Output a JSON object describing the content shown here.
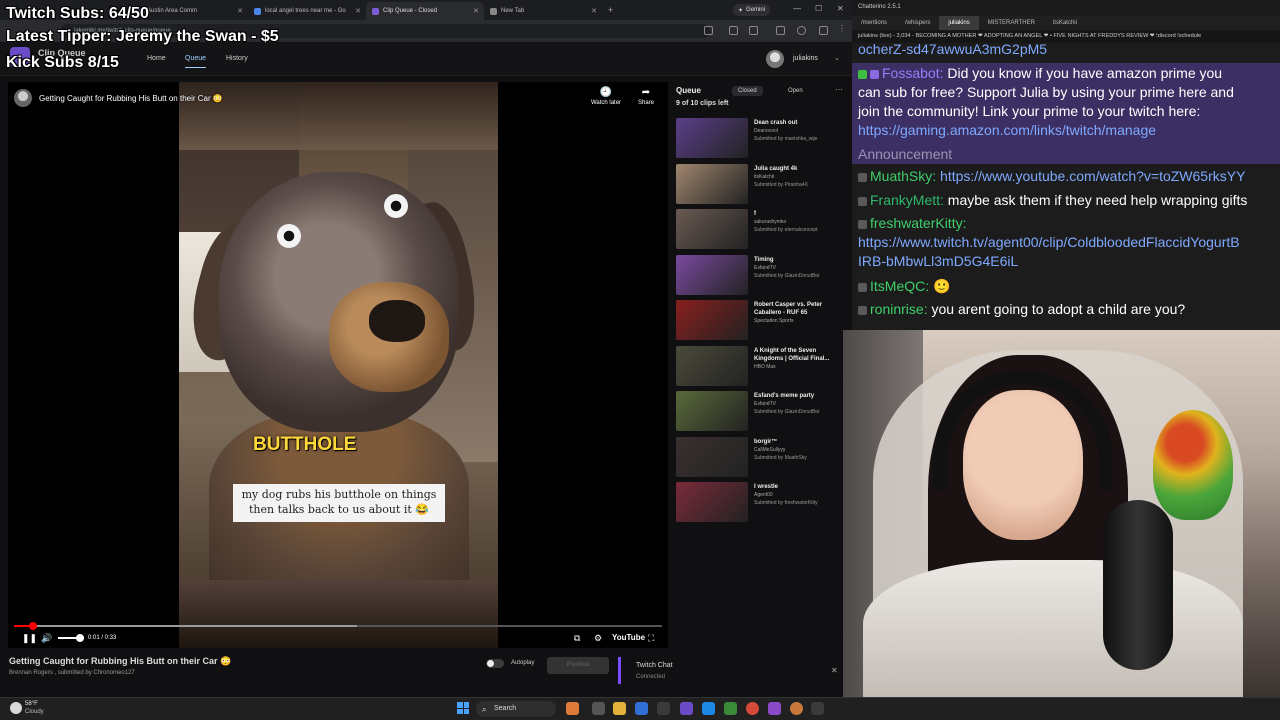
{
  "browser": {
    "tabs": [
      {
        "title": "Austin Area Comm"
      },
      {
        "title": "local angel trees near me - Go"
      },
      {
        "title": "Clip Queue - Closed"
      },
      {
        "title": "New Tab"
      }
    ],
    "gemini_label": "Gemini",
    "url": "jakemiki.me/twitch-clip-queue/queue"
  },
  "site": {
    "name": "Clip Queue",
    "nav": [
      "Home",
      "Queue",
      "History"
    ],
    "username": "juliakins"
  },
  "player": {
    "title": "Getting Caught for Rubbing His Butt on their Car 😳",
    "watch_later": "Watch later",
    "share": "Share",
    "caption_big": "BUTTHOLE",
    "caption_line1": "my dog rubs his butthole on things",
    "caption_line2": "then talks back to us about it 😂",
    "time": "0:01 / 0:33",
    "progress": 0.03,
    "buffered": 0.53,
    "youtube_label": "YouTube"
  },
  "below": {
    "title": "Getting Caught for Rubbing His Butt on their Car 😳",
    "sub": "Brennan Rogers , submitted by Chronomeo127",
    "autoplay": "Autoplay",
    "previous": "Previous",
    "chat_status_title": "Twitch Chat",
    "chat_status_sub": "Connected"
  },
  "queue": {
    "title": "Queue",
    "tab_closed": "Closed",
    "tab_open": "Open",
    "count": "9 of 10 clips left",
    "items": [
      {
        "title": "Dean crash out",
        "channel": "Deanocool",
        "submitted": "Submitted by manishka_wije",
        "color": "#5b3f8a"
      },
      {
        "title": "Julia caught 4k",
        "channel": "itsKatchii",
        "submitted": "Submitted by Piranha4X",
        "color": "#a0866e"
      },
      {
        "title": "f",
        "channel": "sakurashymko",
        "submitted": "Submitted by eternalconcept",
        "color": "#6a5a52"
      },
      {
        "title": "Timing",
        "channel": "EsfandTV",
        "submitted": "Submitted by GlazinDonutBoi",
        "color": "#7a4aa0"
      },
      {
        "title": "Robert Casper vs. Peter Caballero - RUF 65",
        "channel": "Spectation Sports",
        "submitted": "",
        "color": "#8a1e1e"
      },
      {
        "title": "A Knight of the Seven Kingdoms | Official Final...",
        "channel": "HBO Max",
        "submitted": "",
        "color": "#4a4a3a"
      },
      {
        "title": "Esfand's meme party",
        "channel": "EsfandTV",
        "submitted": "Submitted by GlazinDonutBoi",
        "color": "#5a6a3a"
      },
      {
        "title": "borgir™",
        "channel": "CallMeSullyyy",
        "submitted": "Submitted by MuathSky",
        "color": "#3a3030"
      },
      {
        "title": "I wrestle",
        "channel": "Agent00",
        "submitted": "Submitted by freshwaterKitty",
        "color": "#7a2a3a"
      }
    ]
  },
  "chat": {
    "app_title": "Chatterino 2.5.1",
    "tabs": [
      "/mentions",
      "/whispers",
      "juliakins",
      "MISTERARTHER",
      "itsKatchii"
    ],
    "split_header": "juliakins (live) - 3,034 - BECOMING A MOTHER ❤ ADOPTING AN ANGEL ❤ • FIVE NIGHTS AT FREDDYS REVIEW ❤ !discord !schedule",
    "top_fragment": "ocherZ-sd47awwuA3mG2pM5",
    "bot_user": "Fossabot:",
    "bot_msg_1": "Did you know if you have amazon prime you",
    "bot_msg_2": "can sub for free? Support Julia by using your prime here and",
    "bot_msg_3": "join the community! Link your prime to your twitch here:",
    "bot_link": "https://gaming.amazon.com/links/twitch/manage",
    "announcement": "Announcement",
    "messages": [
      {
        "user": "MuathSky:",
        "text": "https://www.youtube.com/watch?v=toZW65rksYY",
        "color": "#3fcf6a",
        "is_link": true
      },
      {
        "user": "FrankyMett:",
        "text": "maybe ask them if they need help wrapping gifts",
        "color": "#2fb96a",
        "is_link": false
      },
      {
        "user": "freshwaterKitty:",
        "text": "",
        "color": "#3fcf6a",
        "is_link": false
      },
      {
        "user": "",
        "text": "https://www.twitch.tv/agent00/clip/ColdbloodedFlaccidYogurtB",
        "color": "#7fa9ff",
        "is_link": true
      },
      {
        "user": "",
        "text": "IRB-bMbwLl3mD5G4E6iL",
        "color": "#7fa9ff",
        "is_link": true
      },
      {
        "user": "ItsMeQC:",
        "text": "🙂",
        "color": "#3fcf6a",
        "is_link": false
      },
      {
        "user": "roninrise:",
        "text": "you arent going to adopt a child are you?",
        "color": "#3fcf6a",
        "is_link": false
      }
    ]
  },
  "overlay": {
    "subs": "Twitch Subs: 64/50",
    "tipper": "Latest Tipper: Jeremy the Swan - $5",
    "kick": "Kick Subs 8/15"
  },
  "taskbar": {
    "temp": "58°F",
    "condition": "Cloudy",
    "search": "Search"
  },
  "icons": {
    "pause": "pause-icon",
    "volume": "volume-icon",
    "captions": "captions-icon",
    "settings": "settings-icon",
    "fullscreen": "fullscreen-icon"
  }
}
